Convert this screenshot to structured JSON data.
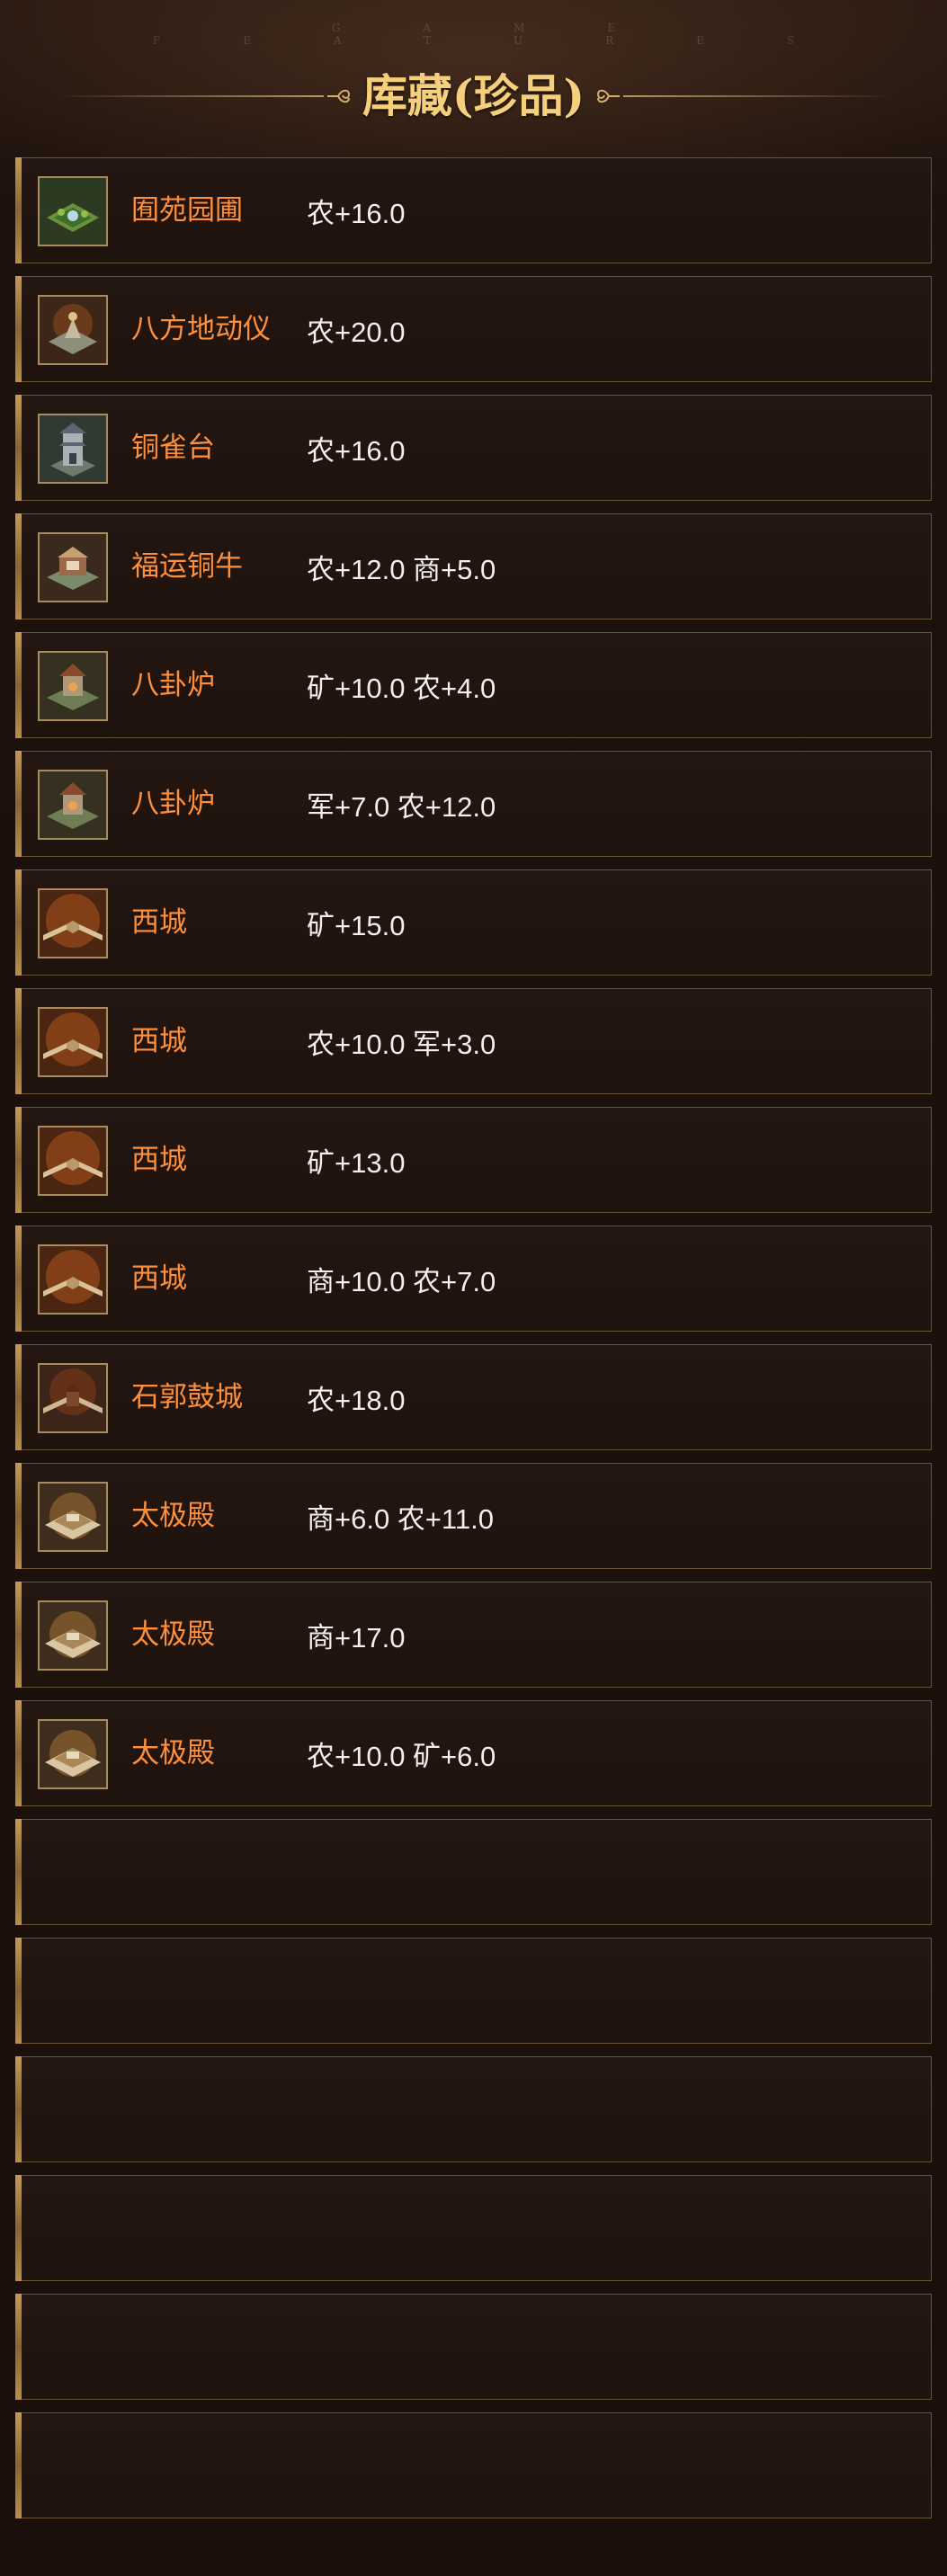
{
  "header": {
    "subtitle": "GAME FEATURES",
    "title": "库藏(珍品)"
  },
  "colors": {
    "accent_gold": "#f5cf7c",
    "item_name": "#ff8f3b",
    "attr_text": "#f4efe8",
    "row_border": "#6a5236"
  },
  "items": [
    {
      "name": "囿苑园圃",
      "attr": "农+16.0",
      "icon": "garden-icon"
    },
    {
      "name": "八方地动仪",
      "attr": "农+20.0",
      "icon": "seismograph-icon"
    },
    {
      "name": "铜雀台",
      "attr": "农+16.0",
      "icon": "tower-icon"
    },
    {
      "name": "福运铜牛",
      "attr": "农+12.0 商+5.0",
      "icon": "bronze-ox-icon"
    },
    {
      "name": "八卦炉",
      "attr": "矿+10.0 农+4.0",
      "icon": "furnace-icon"
    },
    {
      "name": "八卦炉",
      "attr": "军+7.0 农+12.0",
      "icon": "furnace-icon"
    },
    {
      "name": "西城",
      "attr": "矿+15.0",
      "icon": "city-wall-icon"
    },
    {
      "name": "西城",
      "attr": "农+10.0 军+3.0",
      "icon": "city-wall-icon"
    },
    {
      "name": "西城",
      "attr": "矿+13.0",
      "icon": "city-wall-icon"
    },
    {
      "name": "西城",
      "attr": "商+10.0 农+7.0",
      "icon": "city-wall-icon"
    },
    {
      "name": "石郭鼓城",
      "attr": "农+18.0",
      "icon": "drum-city-icon"
    },
    {
      "name": "太极殿",
      "attr": "商+6.0 农+11.0",
      "icon": "palace-icon"
    },
    {
      "name": "太极殿",
      "attr": "商+17.0",
      "icon": "palace-icon"
    },
    {
      "name": "太极殿",
      "attr": "农+10.0 矿+6.0",
      "icon": "palace-icon"
    },
    {
      "name": "",
      "attr": "",
      "icon": ""
    },
    {
      "name": "",
      "attr": "",
      "icon": ""
    },
    {
      "name": "",
      "attr": "",
      "icon": ""
    },
    {
      "name": "",
      "attr": "",
      "icon": ""
    },
    {
      "name": "",
      "attr": "",
      "icon": ""
    },
    {
      "name": "",
      "attr": "",
      "icon": ""
    }
  ]
}
